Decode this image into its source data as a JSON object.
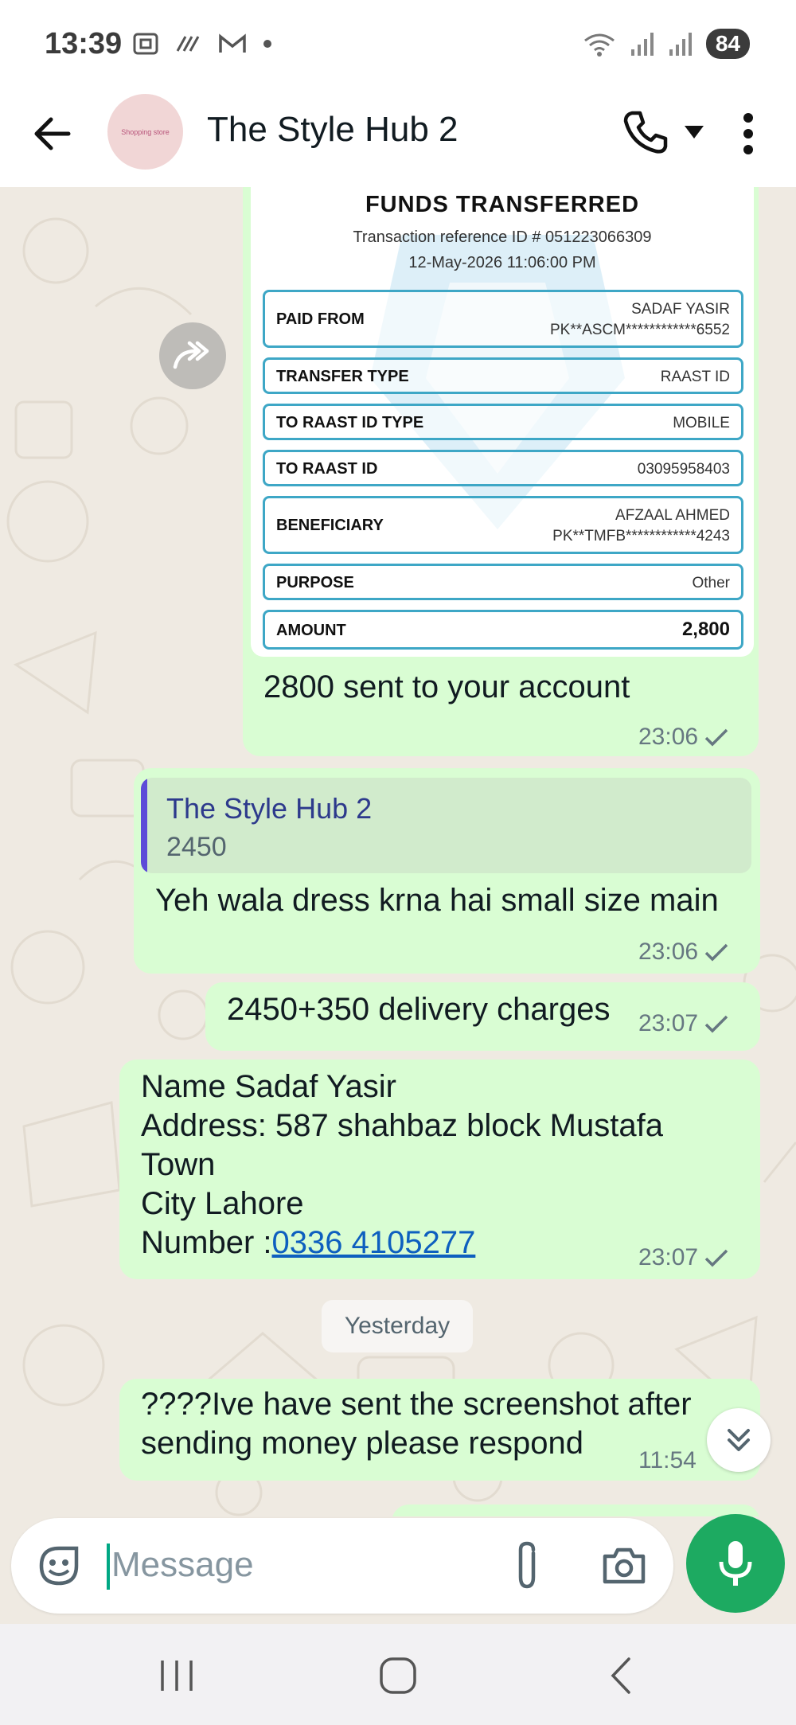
{
  "status_bar": {
    "time": "13:39",
    "battery": "84",
    "icons": [
      "screenshot-icon",
      "call-forward-icon",
      "gmail-icon",
      "dot-icon",
      "wifi-icon",
      "signal-icon",
      "signal-icon"
    ]
  },
  "header": {
    "title": "The Style Hub 2",
    "avatar_text": "Shopping store",
    "icons": [
      "back-arrow-icon",
      "phone-icon",
      "chevron-down-icon",
      "more-vert-icon"
    ]
  },
  "receipt": {
    "title": "FUNDS TRANSFERRED",
    "reference": "Transaction reference ID # 051223066309",
    "datetime": "12-May-2026 11:06:00 PM",
    "rows": [
      {
        "label": "PAID FROM",
        "value": "SADAF YASIR",
        "value2": "PK**ASCM************6552"
      },
      {
        "label": "TRANSFER TYPE",
        "value": "RAAST ID"
      },
      {
        "label": "TO RAAST ID TYPE",
        "value": "MOBILE"
      },
      {
        "label": "TO RAAST ID",
        "value": "03095958403"
      },
      {
        "label": "BENEFICIARY",
        "value": "AFZAAL AHMED",
        "value2": "PK**TMFB************4243"
      },
      {
        "label": "PURPOSE",
        "value": "Other"
      },
      {
        "label": "AMOUNT",
        "value": "2,800"
      }
    ]
  },
  "messages": [
    {
      "text": "2800 sent to your account",
      "time": "23:06"
    },
    {
      "quote_name": "The Style Hub 2",
      "quote_text": "2450",
      "text": "Yeh wala dress krna hai small size main",
      "time": "23:06"
    },
    {
      "text": "2450+350 delivery charges",
      "time": "23:07"
    },
    {
      "line1": "Name Sadaf Yasir",
      "line2": "Address: 587 shahbaz block Mustafa",
      "line3": "Town",
      "line4": "City Lahore",
      "line5_prefix": "Number :",
      "line5_link": "0336 4105277",
      "time": "23:07"
    },
    {
      "line1": "????Ive have sent the screenshot after",
      "line2": "sending money please respond",
      "time": "11:54"
    }
  ],
  "day_separator": "Yesterday",
  "input": {
    "placeholder": "Message"
  },
  "colors": {
    "bubble": "#d9fdd3",
    "chat_bg": "#efeae2",
    "accent": "#1daa61",
    "link": "#0d5fbf",
    "receipt_border": "#3ea7c6"
  }
}
